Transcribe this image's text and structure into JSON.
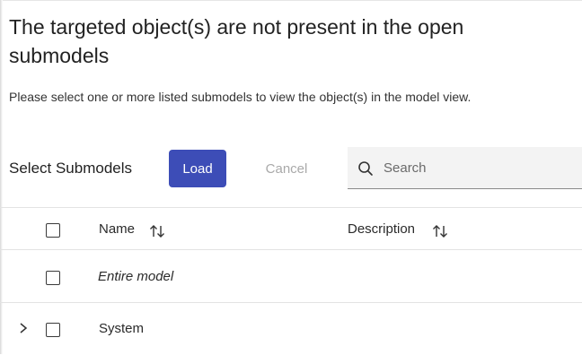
{
  "dialog": {
    "title": "The targeted object(s) are not present in the open submodels",
    "message": "Please select one or more listed submodels to view the object(s) in the model view."
  },
  "toolbar": {
    "section_label": "Select Submodels",
    "load_label": "Load",
    "cancel_label": "Cancel"
  },
  "search": {
    "placeholder": "Search",
    "value": ""
  },
  "table": {
    "columns": [
      "Name",
      "Description"
    ],
    "rows": [
      {
        "name": "Entire model",
        "description": "",
        "expandable": false,
        "italic": true,
        "checked": false
      },
      {
        "name": "System",
        "description": "",
        "expandable": true,
        "italic": false,
        "checked": false
      }
    ]
  },
  "colors": {
    "primary": "#3d4db7",
    "disabled_text": "#a9a9a9",
    "search_bg": "#f3f3f3"
  }
}
